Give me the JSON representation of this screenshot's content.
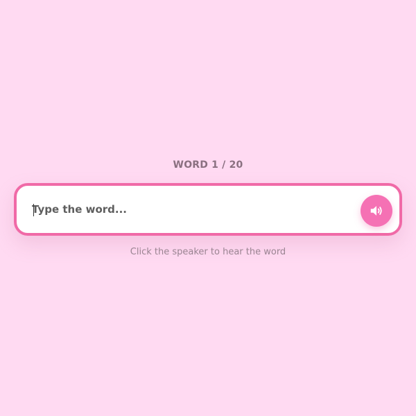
{
  "progress": {
    "label": "WORD 1 / 20"
  },
  "input": {
    "value": "",
    "placeholder": "Type the word..."
  },
  "speaker": {
    "icon": "speaker-icon"
  },
  "hint": {
    "text": "Click the speaker to hear the word"
  },
  "colors": {
    "background": "#ffdaf2",
    "accent": "#f06aa7",
    "button": "#f571b4"
  }
}
